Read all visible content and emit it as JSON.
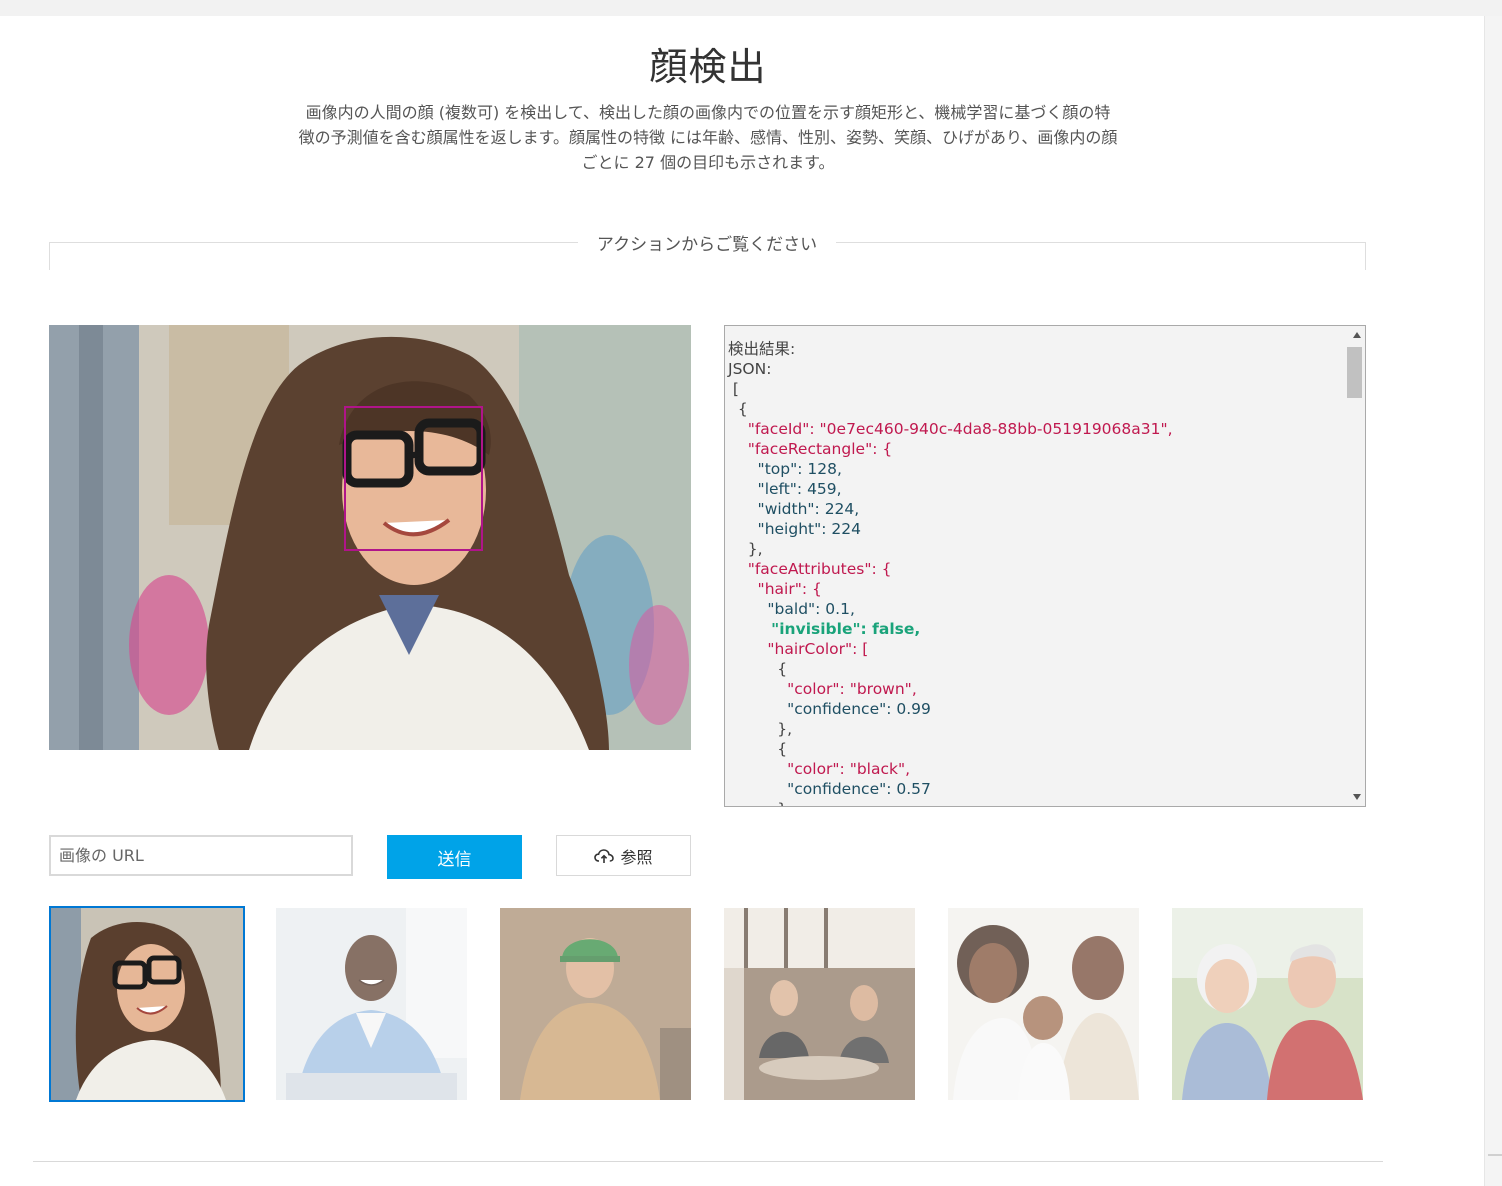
{
  "page": {
    "title": "顔検出",
    "description_lines": [
      "画像内の人間の顔 (複数可) を検出して、検出した顔の画像内での位置を示す顔矩形と、機械学習に基づく顔の特",
      "徴の予測値を含む顔属性を返します。顔属性の特徴 には年齢、感情、性別、姿勢、笑顔、ひげがあり、画像内の顔",
      "ごとに 27 個の目印も示されます。"
    ],
    "section_label": "アクションからご覧ください"
  },
  "result": {
    "lines": [
      "検出結果:",
      "JSON:",
      " [",
      "  {",
      "    \"faceId\": \"0e7ec460-940c-4da8-88bb-051919068a31\",",
      "    \"faceRectangle\": {",
      "      \"top\": 128,",
      "      \"left\": 459,",
      "      \"width\": 224,",
      "      \"height\": 224",
      "    },",
      "    \"faceAttributes\": {",
      "      \"hair\": {",
      "        \"bald\": 0.1,",
      "        \"invisible\": false,",
      "        \"hairColor\": [",
      "          {",
      "            \"color\": \"brown\",",
      "            \"confidence\": 0.99",
      "          },",
      "          {",
      "            \"color\": \"black\",",
      "            \"confidence\": 0.57",
      "          },"
    ]
  },
  "controls": {
    "url_placeholder": "画像の URL",
    "url_value": "",
    "send_label": "送信",
    "browse_label": "参照",
    "browse_icon": "cloud-upload-icon"
  },
  "thumbnails": [
    {
      "name": "woman-with-glasses",
      "selected": true
    },
    {
      "name": "smiling-man-sitting",
      "selected": false
    },
    {
      "name": "worker-with-hardhat",
      "selected": false
    },
    {
      "name": "people-in-cafe",
      "selected": false
    },
    {
      "name": "family-with-baby",
      "selected": false
    },
    {
      "name": "elderly-couple",
      "selected": false
    }
  ],
  "colors": {
    "accent": "#00a3e8",
    "face_box": "#b0148a",
    "selected_border": "#0078d4",
    "json_key": "#c0194f",
    "json_number": "#1f4f63",
    "json_bool": "#1aa37a"
  }
}
